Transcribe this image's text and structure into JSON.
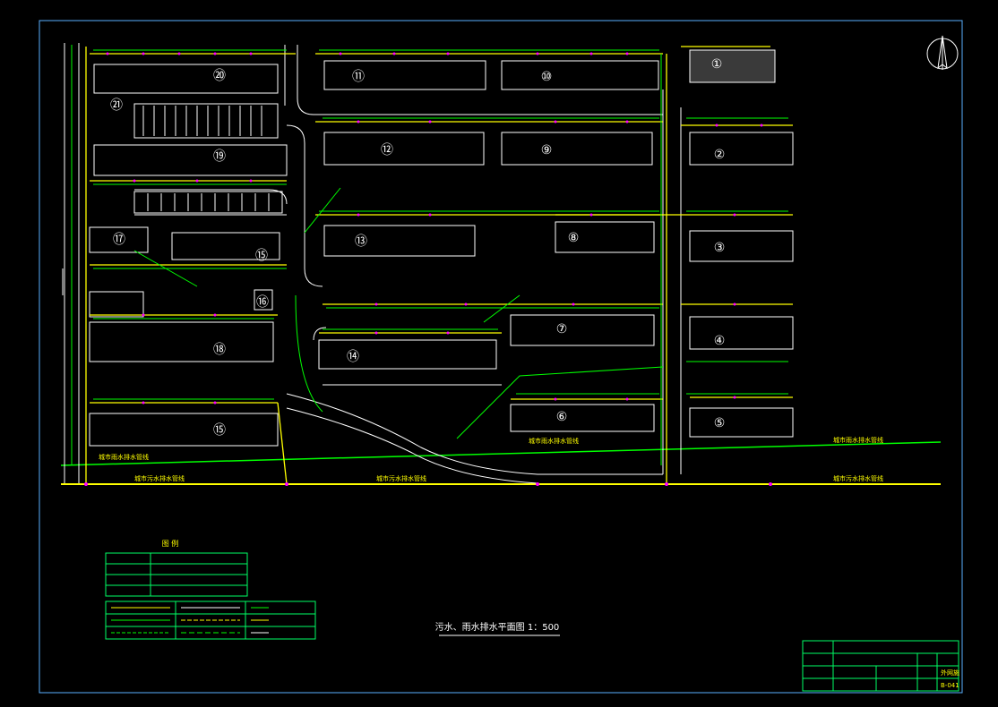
{
  "colors": {
    "background": "#000000",
    "frame": "#5ab0ff",
    "building": "#ffffff",
    "sewer": "#ffff00",
    "rain": "#00ff00",
    "label": "#00ff66",
    "title_block": "#00ff66",
    "accent": "#ff00ff"
  },
  "drawing": {
    "title": "污水、雨水排水平面图 1：500",
    "north_symbol": "north-arrow"
  },
  "roads": {
    "city_rain_main": "城市雨水排水管线",
    "city_sewer_main": "城市污水排水管线"
  },
  "buildings": [
    {
      "id": "11",
      "label": "⑪"
    },
    {
      "id": "10",
      "label": "⑩"
    },
    {
      "id": "1",
      "label": "①"
    },
    {
      "id": "20",
      "label": "⑳"
    },
    {
      "id": "21",
      "label": "㉑"
    },
    {
      "id": "12",
      "label": "⑫"
    },
    {
      "id": "9",
      "label": "⑨"
    },
    {
      "id": "2",
      "label": "②"
    },
    {
      "id": "19",
      "label": "⑲"
    },
    {
      "id": "13",
      "label": "⑬"
    },
    {
      "id": "8",
      "label": "⑧"
    },
    {
      "id": "3",
      "label": "③"
    },
    {
      "id": "17",
      "label": "⑰"
    },
    {
      "id": "15",
      "label": "⑮"
    },
    {
      "id": "16",
      "label": "⑯"
    },
    {
      "id": "7",
      "label": "⑦"
    },
    {
      "id": "4",
      "label": "④"
    },
    {
      "id": "14",
      "label": "⑭"
    },
    {
      "id": "18",
      "label": "⑱"
    },
    {
      "id": "6",
      "label": "⑥"
    },
    {
      "id": "5",
      "label": "⑤"
    },
    {
      "id": "15b",
      "label": "⑮"
    }
  ],
  "legend": {
    "title": "图 例"
  },
  "title_block": {
    "page_code": "B-041",
    "sheet_label": "外网施"
  }
}
